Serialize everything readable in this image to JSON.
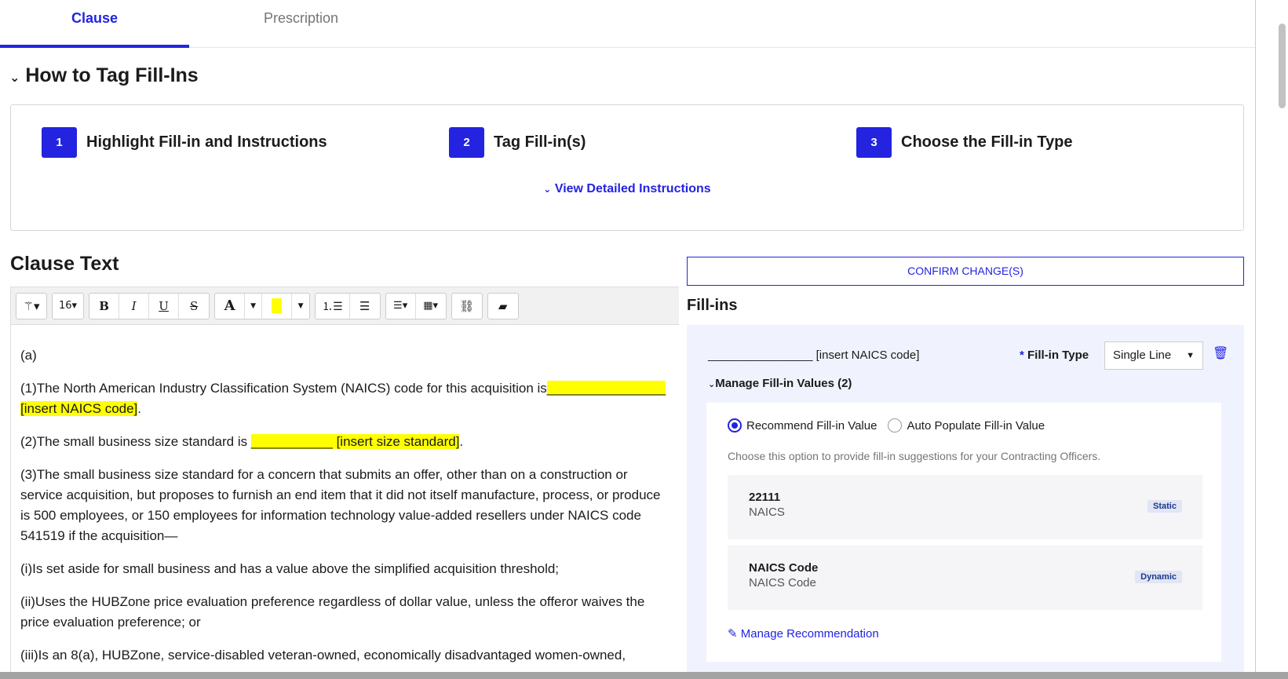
{
  "tabs": [
    {
      "label": "Clause",
      "active": true
    },
    {
      "label": "Prescription",
      "active": false
    }
  ],
  "how_to": {
    "title": "How to Tag Fill-Ins",
    "steps": [
      {
        "num": "1",
        "label": "Highlight Fill-in and Instructions"
      },
      {
        "num": "2",
        "label": "Tag Fill-in(s)"
      },
      {
        "num": "3",
        "label": "Choose the Fill-in Type"
      }
    ],
    "view_link": "View Detailed Instructions"
  },
  "clause": {
    "title": "Clause Text",
    "toolbar": {
      "font_size": "16",
      "bold": "B",
      "italic": "I",
      "underline": "U",
      "strike": "S",
      "font_color": "A",
      "highlight_color": "#ffff00"
    },
    "paragraphs": {
      "a": "(a)",
      "p1_pre": "(1)The North American Industry Classification System (NAICS) code for this acquisition is",
      "p1_hl": "________________ [insert NAICS code]",
      "p1_post": ".",
      "p2_pre": "(2)The small business size standard is ",
      "p2_hl": "___________ [insert size standard]",
      "p2_post": ".",
      "p3": "(3)The small business size standard for a concern that submits an offer, other than on a construction or service acquisition, but proposes to furnish an end item that it did not itself manufacture, process, or produce is 500 employees, or 150 employees for information technology value-added resellers under NAICS code 541519 if the acquisition—",
      "i": "(i)Is set aside for small business and has a value above the simplified acquisition threshold;",
      "ii": "(ii)Uses the HUBZone price evaluation preference regardless of dollar value, unless the offeror waives the price evaluation preference; or",
      "iii": "(iii)Is an 8(a), HUBZone, service-disabled veteran-owned, economically disadvantaged women-owned,"
    }
  },
  "confirm_label": "CONFIRM CHANGE(S)",
  "fillins": {
    "title": "Fill-ins",
    "item": "________________ [insert NAICS code]",
    "type_label": "Fill-in Type",
    "required": "*",
    "type_value": "Single Line",
    "manage_label": "Manage Fill-in Values (2)",
    "radio_recommend": "Recommend Fill-in Value",
    "radio_auto": "Auto Populate Fill-in Value",
    "selected": "Recommend Fill-in Value",
    "hint": "Choose this option to provide fill-in suggestions for your Contracting Officers.",
    "values": [
      {
        "title": "22111",
        "sub": "NAICS",
        "badge": "Static"
      },
      {
        "title": "NAICS Code",
        "sub": "NAICS Code",
        "badge": "Dynamic"
      }
    ],
    "manage_rec": "Manage Recommendation"
  },
  "colors": {
    "accent": "#2323e0",
    "highlight": "#ffff00",
    "panel": "#f0f3fd"
  }
}
